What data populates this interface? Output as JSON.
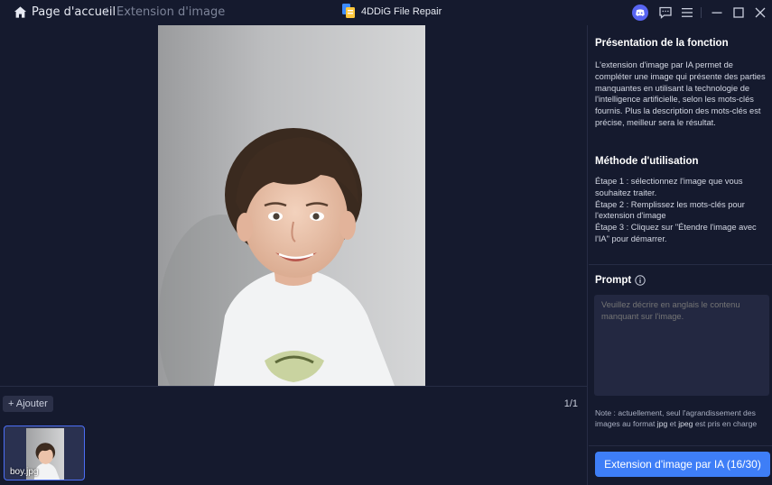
{
  "titlebar": {
    "home_label": "Page d'accueil",
    "separator": "/",
    "current_label": "Extension d'image",
    "app_title": "4DDiG File Repair"
  },
  "editor": {
    "add_button": "+ Ajouter",
    "page_count": "1/1",
    "thumbnails": [
      {
        "name": "boy.jpg"
      }
    ]
  },
  "side_panel": {
    "presentation_title": "Présentation de la fonction",
    "presentation_text": "L'extension d'image par IA permet de compléter une image qui présente des parties manquantes en utilisant la technologie de l'intelligence artificielle, selon les mots-clés fournis. Plus la description des mots-clés est précise, meilleur sera le résultat.",
    "method_title": "Méthode d'utilisation",
    "steps": [
      "Étape 1 : sélectionnez l'image que vous souhaitez traiter.",
      "Étape 2 : Remplissez les mots-clés pour l'extension d'image",
      "Étape 3 : Cliquez sur \"Étendre l'image avec l'IA\" pour démarrer."
    ],
    "prompt_title": "Prompt",
    "prompt_placeholder": "Veuillez décrire en anglais le contenu manquant sur l'image.",
    "prompt_value": "",
    "note_prefix": "Note : actuellement, seul l'agrandissement des images au format ",
    "note_fmt1": "jpg",
    "note_mid": " et ",
    "note_fmt2": "jpeg",
    "note_suffix": " est pris en charge",
    "cta_label": "Extension d'image par IA (16/30)"
  },
  "colors": {
    "background": "#151a2e",
    "accent": "#3e7ef7",
    "input_bg": "#232841"
  }
}
